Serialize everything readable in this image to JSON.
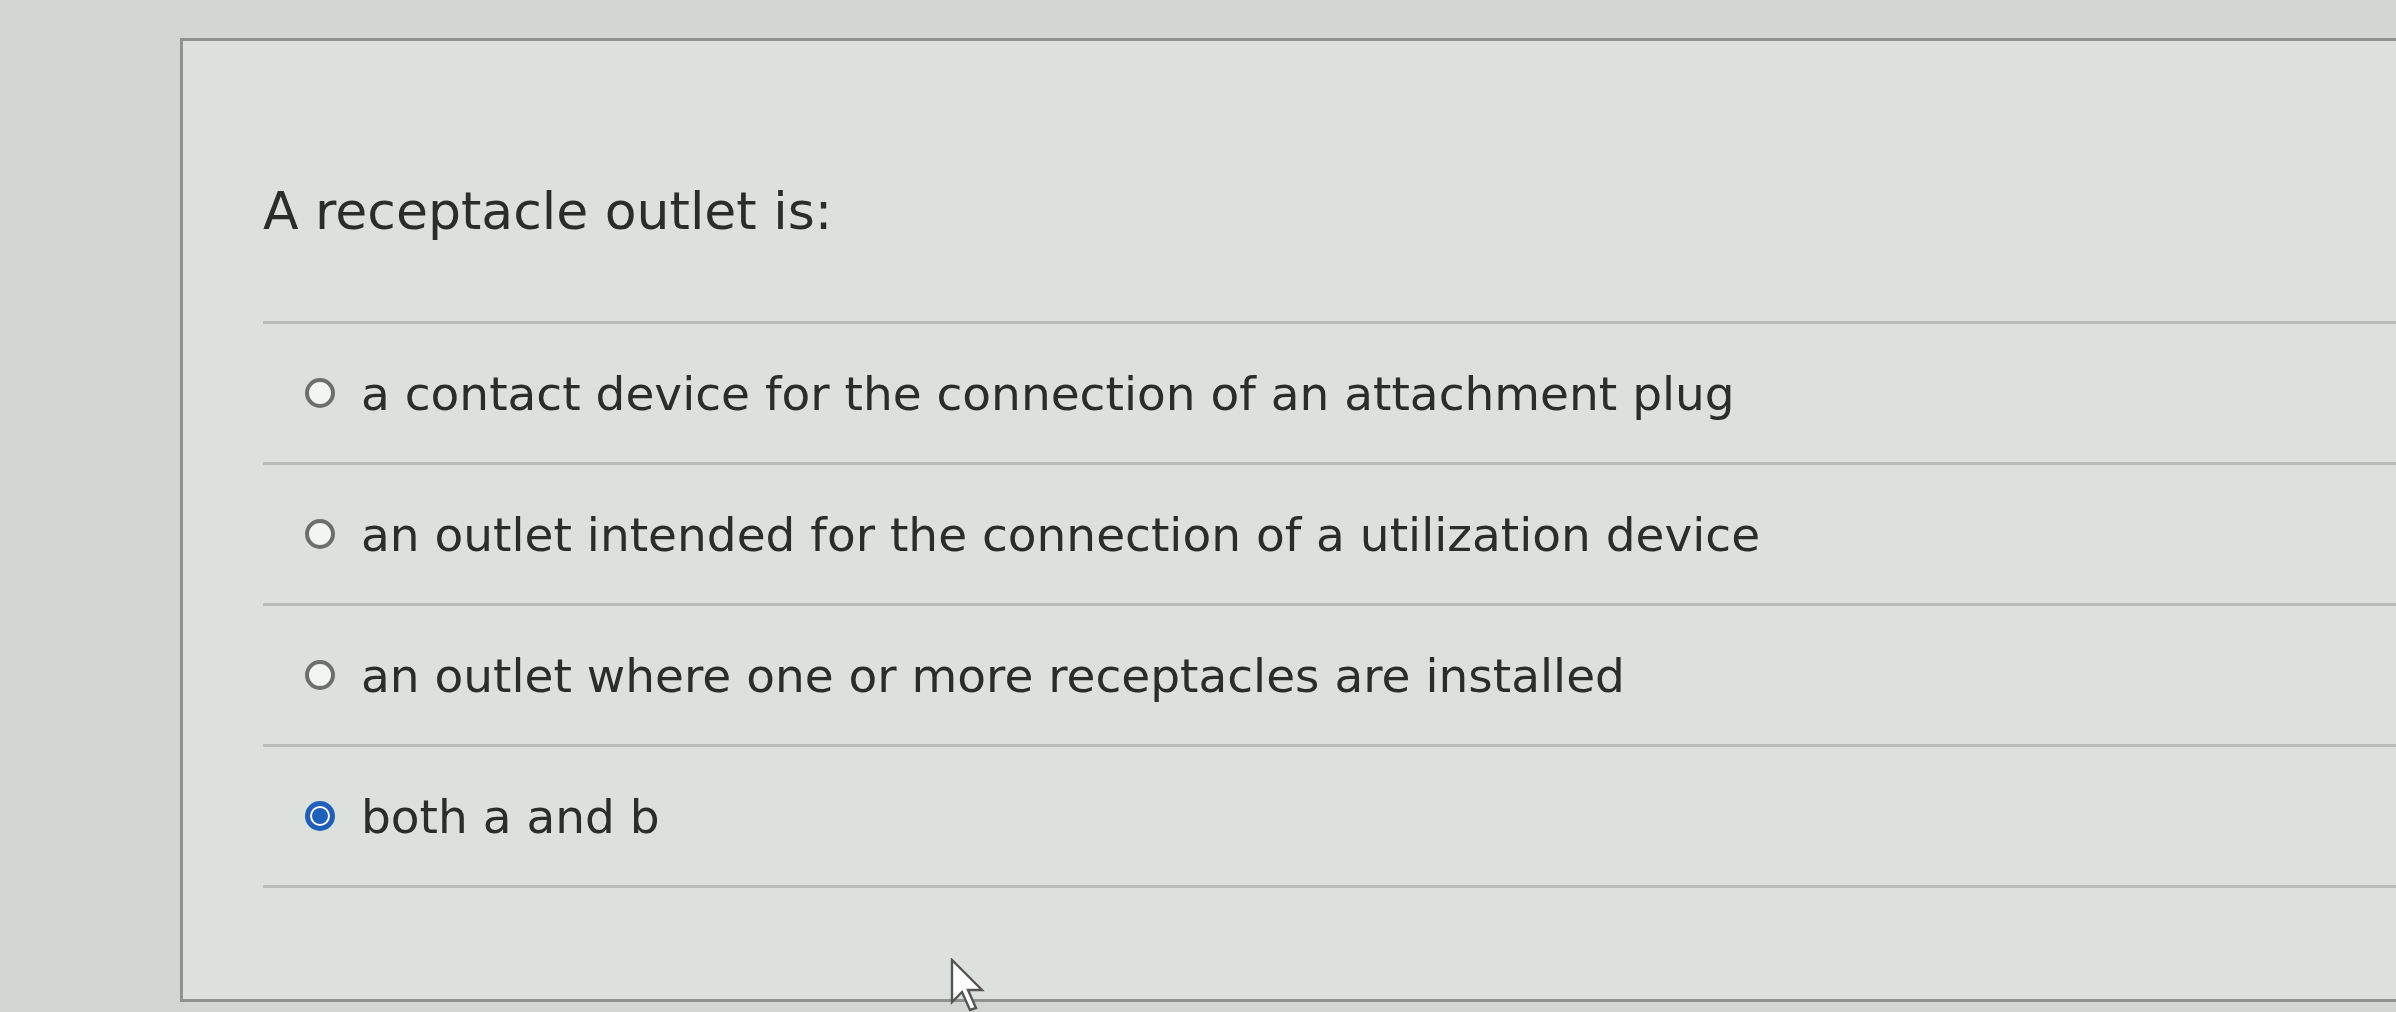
{
  "question": {
    "text": "A receptacle outlet is:"
  },
  "options": [
    {
      "label": "a contact device for the connection of an attachment plug",
      "selected": false
    },
    {
      "label": "an outlet intended for the connection of a utilization device",
      "selected": false
    },
    {
      "label": "an outlet where one or more receptacles are installed",
      "selected": false
    },
    {
      "label": "both a and b",
      "selected": true
    }
  ]
}
